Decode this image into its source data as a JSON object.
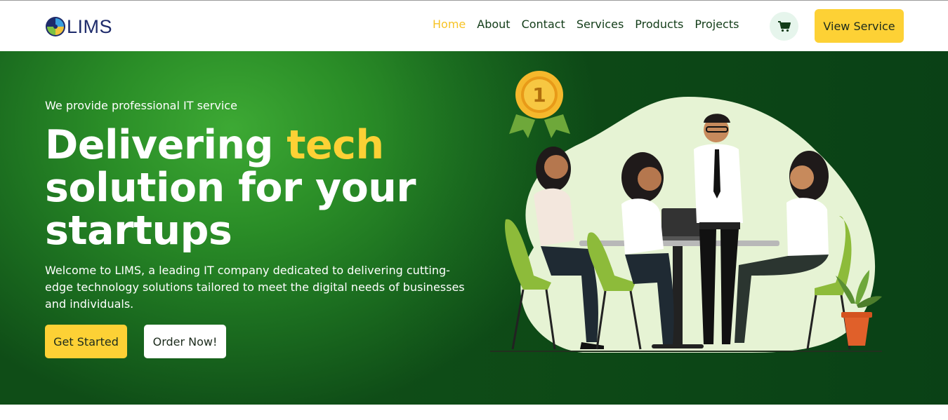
{
  "brand": {
    "logo_text": "LIMS",
    "colors": {
      "accent": "#fdd135",
      "nav_text": "#123c18",
      "hero_green": "#2a8d27",
      "hero_dark": "#0f4d17"
    }
  },
  "nav": {
    "items": [
      {
        "label": "Home",
        "active": true
      },
      {
        "label": "About",
        "active": false
      },
      {
        "label": "Contact",
        "active": false
      },
      {
        "label": "Services",
        "active": false
      },
      {
        "label": "Products",
        "active": false
      },
      {
        "label": "Projects",
        "active": false
      }
    ],
    "cart_icon": "cart-icon",
    "cta_label": "View Service"
  },
  "hero": {
    "tagline": "We provide professional IT service",
    "headline_pre": "Delivering ",
    "headline_highlight": "tech",
    "headline_post": " solution for your startups",
    "description": "Welcome to LIMS, a leading IT company dedicated to delivering cutting-edge technology solutions tailored to meet the digital needs of businesses and individuals.",
    "primary_button": "Get Started",
    "secondary_button": "Order Now!",
    "medal_text": "1",
    "illustration_icon": "team-meeting-illustration"
  }
}
